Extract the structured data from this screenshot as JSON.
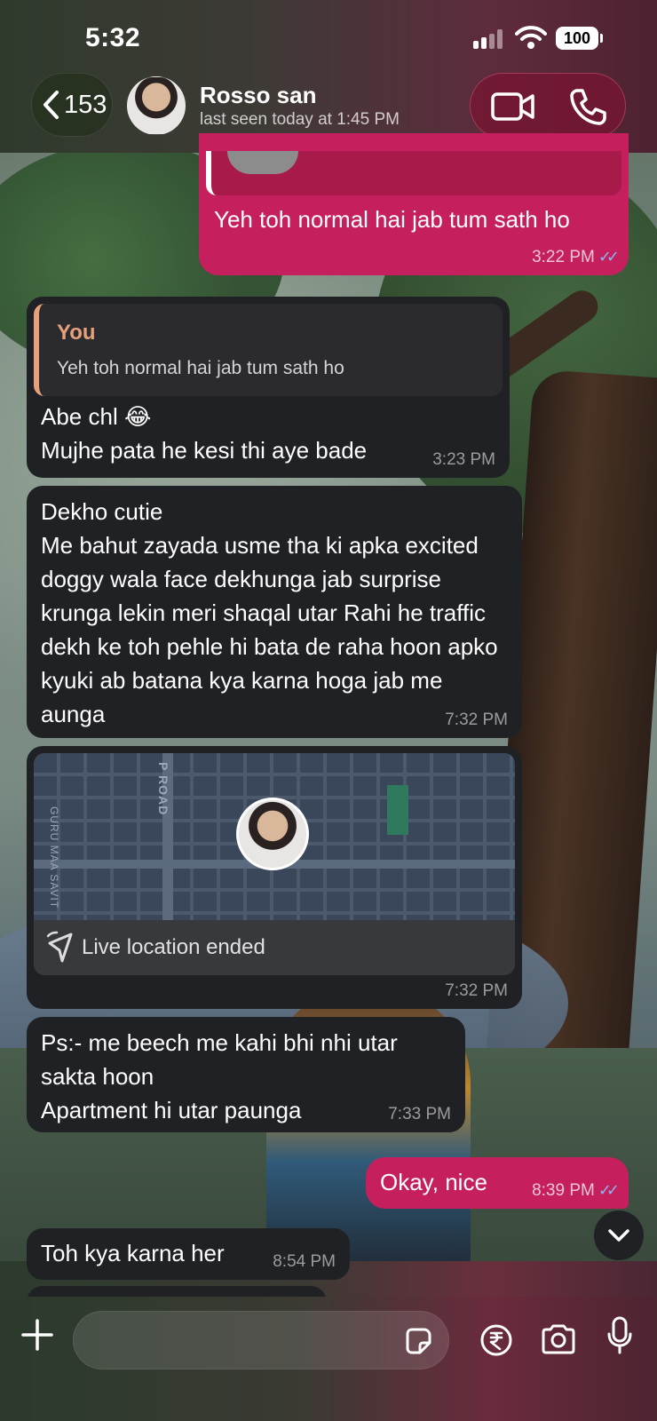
{
  "status_bar": {
    "time": "5:32",
    "battery": "100"
  },
  "header": {
    "back_count": "153",
    "contact_name": "Rosso san",
    "last_seen": "last seen today at 1:45 PM"
  },
  "messages": [
    {
      "direction": "out",
      "text": "Yeh toh normal hai jab tum sath ho",
      "time": "3:22 PM",
      "status": "read"
    },
    {
      "direction": "in",
      "quote": {
        "author": "You",
        "text": "Yeh toh normal hai jab tum sath ho"
      },
      "text_line1": "Abe chl 😂",
      "text_line2": "Mujhe pata he kesi thi aye bade",
      "time": "3:23 PM"
    },
    {
      "direction": "in",
      "text": "Dekho cutie\nMe bahut zayada usme tha ki apka excited doggy wala face dekhunga jab surprise krunga lekin meri shaqal utar Rahi he traffic dekh ke toh pehle hi bata de raha hoon apko kyuki ab batana kya karna hoga jab me aunga",
      "time": "7:32 PM"
    },
    {
      "direction": "in",
      "type": "live_location",
      "map_labels": {
        "road": "P ROAD",
        "street": "GURU MAA SAVIT"
      },
      "label": "Live location ended",
      "time": "7:32 PM"
    },
    {
      "direction": "in",
      "text": "Ps:- me beech me kahi bhi nhi utar sakta hoon\nApartment hi utar paunga",
      "time": "7:33 PM"
    },
    {
      "direction": "out",
      "text": "Okay, nice",
      "time": "8:39 PM",
      "status": "read"
    },
    {
      "direction": "in",
      "text": "Toh kya karna her",
      "time": "8:54 PM"
    }
  ],
  "composer": {
    "placeholder": "",
    "value": ""
  },
  "icons": {
    "back": "chevron-left-icon",
    "video": "video-camera-icon",
    "phone": "phone-icon",
    "plus": "plus-icon",
    "sticker": "sticker-icon",
    "payment": "rupee-icon",
    "camera": "camera-icon",
    "mic": "microphone-icon",
    "scroll_down": "chevron-down-icon",
    "read_ticks": "double-check-icon",
    "live_location": "live-location-icon"
  },
  "colors": {
    "outgoing_bubble": "#c61f5d",
    "incoming_bubble": "#202124",
    "quote_accent": "#e6a07b",
    "read_ticks": "#86b6f5"
  }
}
